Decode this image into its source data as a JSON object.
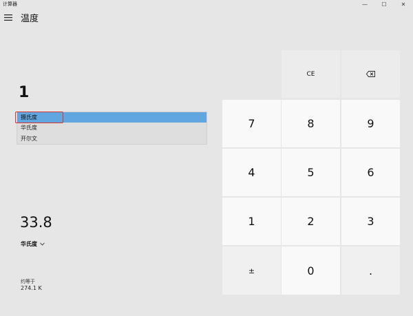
{
  "window": {
    "app_title": "计算器",
    "controls": [
      "—",
      "☐",
      "✕"
    ]
  },
  "header": {
    "mode_title": "温度"
  },
  "input": {
    "value": "1",
    "unit_options": [
      "摄氏度",
      "华氏度",
      "开尔文"
    ],
    "selected_index": 0
  },
  "output": {
    "value": "33.8",
    "unit": "华氏度",
    "approx_label": "约等于",
    "approx_value": "274.1 K"
  },
  "keypad": {
    "ce": "CE",
    "backspace_icon": "backspace-icon",
    "digits": {
      "7": "7",
      "8": "8",
      "9": "9",
      "4": "4",
      "5": "5",
      "6": "6",
      "1": "1",
      "2": "2",
      "3": "3",
      "0": "0"
    },
    "plus_minus": "±",
    "decimal": "."
  },
  "colors": {
    "background": "#e6e6e6",
    "key": "#f9f9f9",
    "selection": "#62a6e0",
    "highlight_border": "#d9342b"
  }
}
